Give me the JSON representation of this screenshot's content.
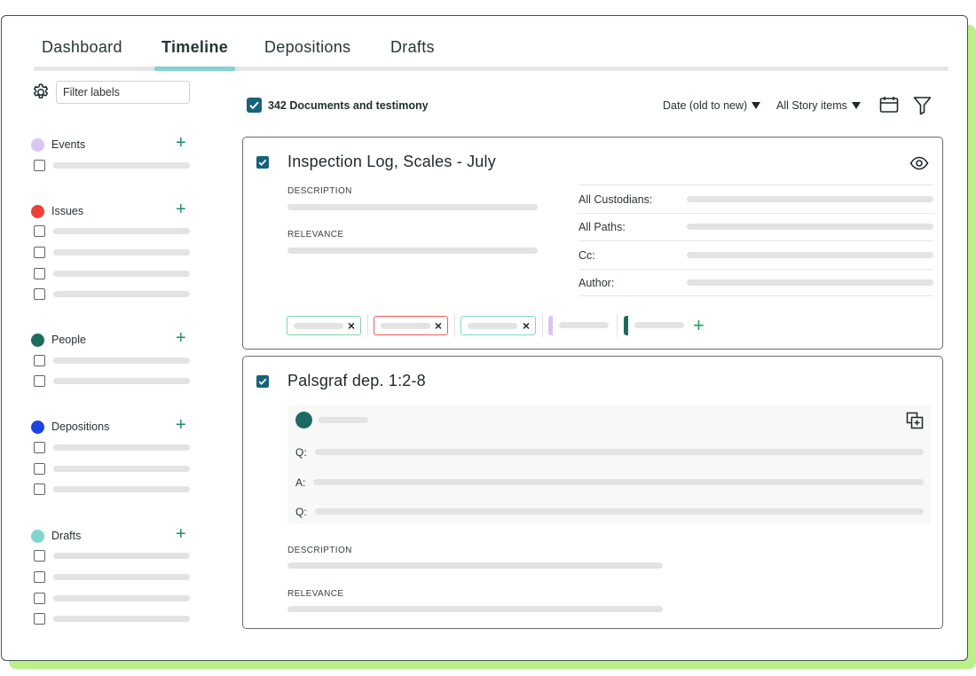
{
  "tabs": [
    {
      "label": "Dashboard",
      "active": false
    },
    {
      "label": "Timeline",
      "active": true
    },
    {
      "label": "Depositions",
      "active": false
    },
    {
      "label": "Drafts",
      "active": false
    }
  ],
  "sidebar": {
    "filter_placeholder": "Filter labels",
    "groups": [
      {
        "label": "Events",
        "color": "#d9c6f2",
        "rows": 1
      },
      {
        "label": "Issues",
        "color": "#ef4136",
        "rows": 4
      },
      {
        "label": "People",
        "color": "#1f6b60",
        "rows": 2
      },
      {
        "label": "Depositions",
        "color": "#1d45e3",
        "rows": 3
      },
      {
        "label": "Drafts",
        "color": "#7fd6cc",
        "rows": 4
      }
    ]
  },
  "toolbar": {
    "count_label": "342 Documents and testimony",
    "sort_label": "Date (old to new)",
    "filter_label": "All Story items"
  },
  "cards": [
    {
      "title": "Inspection Log, Scales - July",
      "description_label": "DESCRIPTION",
      "relevance_label": "RELEVANCE",
      "meta": [
        "All Custodians:",
        "All Paths:",
        "Cc:",
        "Author:"
      ],
      "tag_colors": [
        "#7fd6a8",
        "#ef5a55",
        "#7fd6cc",
        "#d9c6f2",
        "#1f6b60"
      ]
    },
    {
      "title": "Palsgraf dep. 1:2-8",
      "qa": [
        "Q:",
        "A:",
        "Q:"
      ],
      "description_label": "DESCRIPTION",
      "relevance_label": "RELEVANCE"
    }
  ],
  "colors": {
    "accent_teal": "#16627a",
    "tab_underline": "#84d2d2",
    "plus_green": "#1c8c6e",
    "frame_shadow": "#b9f08a"
  }
}
